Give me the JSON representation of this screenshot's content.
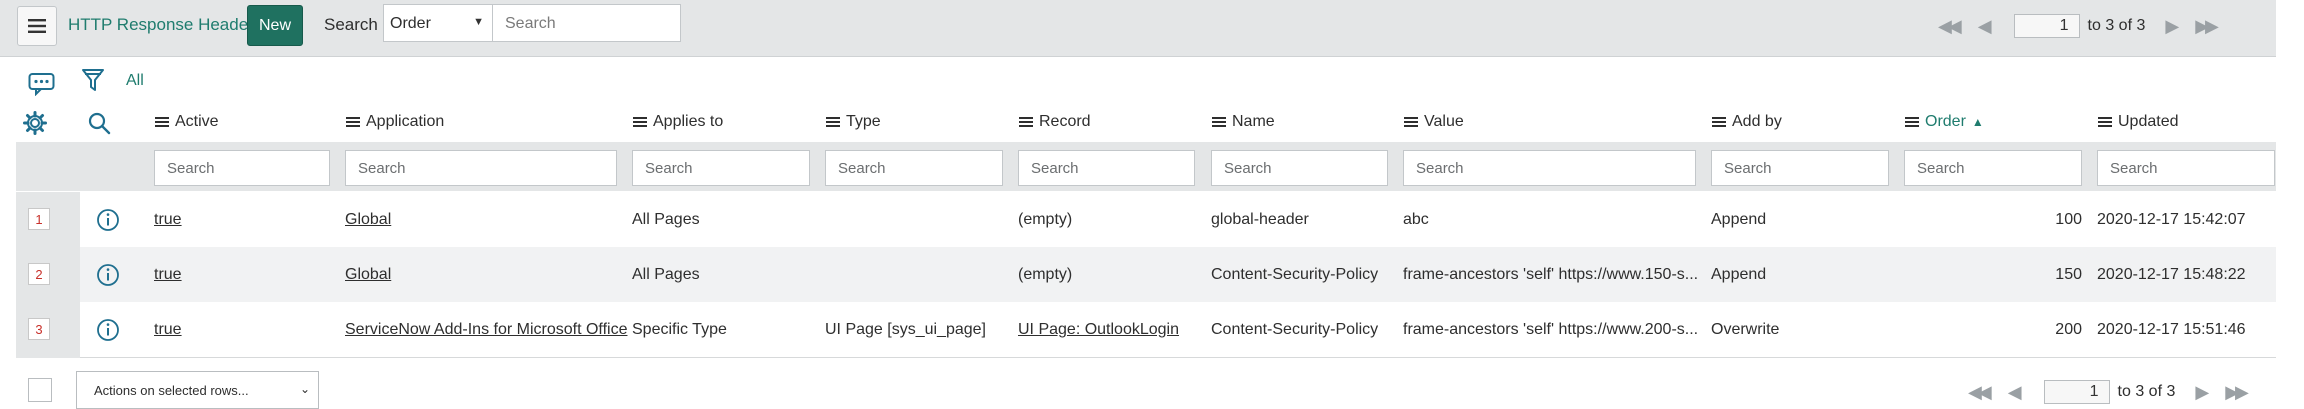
{
  "header": {
    "title": "HTTP Response Headers",
    "new_label": "New",
    "search_label": "Search",
    "search_field_selected": "Order",
    "search_placeholder": "Search"
  },
  "pager": {
    "page_value": "1",
    "range_text": "to 3 of 3"
  },
  "filter": {
    "breadcrumb_all": "All"
  },
  "columns": [
    {
      "label": "Active"
    },
    {
      "label": "Application"
    },
    {
      "label": "Applies to"
    },
    {
      "label": "Type"
    },
    {
      "label": "Record"
    },
    {
      "label": "Name"
    },
    {
      "label": "Value"
    },
    {
      "label": "Add by"
    },
    {
      "label": "Order",
      "sorted": "ascending"
    },
    {
      "label": "Updated"
    }
  ],
  "column_search_placeholder": "Search",
  "rows": [
    {
      "num": "1",
      "active": "true",
      "application": "Global",
      "applies_to": "All Pages",
      "type": "",
      "record": "(empty)",
      "name": "global-header",
      "value": "abc",
      "add_by": "Append",
      "order": "100",
      "updated": "2020-12-17 15:42:07"
    },
    {
      "num": "2",
      "active": "true",
      "application": "Global",
      "applies_to": "All Pages",
      "type": "",
      "record": "(empty)",
      "name": "Content-Security-Policy",
      "value": "frame-ancestors 'self' https://www.150-s...",
      "add_by": "Append",
      "order": "150",
      "updated": "2020-12-17 15:48:22"
    },
    {
      "num": "3",
      "active": "true",
      "application": "ServiceNow Add-Ins for Microsoft Office",
      "applies_to": "Specific Type",
      "type": "UI Page [sys_ui_page]",
      "record": "UI Page: OutlookLogin",
      "name": "Content-Security-Policy",
      "value": "frame-ancestors 'self' https://www.200-s...",
      "add_by": "Overwrite",
      "order": "200",
      "updated": "2020-12-17 15:51:46"
    }
  ],
  "footer": {
    "actions_label": "Actions on selected rows...",
    "page_value": "1",
    "range_text": "to 3 of 3"
  },
  "colors": {
    "accent": "#1f7c6e",
    "new_button": "#1f7160",
    "row_number": "#c8302a"
  },
  "icons": [
    "hamburger-menu-icon",
    "first-page-icon",
    "previous-page-icon",
    "next-page-icon",
    "last-page-icon",
    "chat-bubble-icon",
    "filter-funnel-icon",
    "gear-icon",
    "search-icon",
    "info-icon",
    "chevron-down-icon"
  ]
}
